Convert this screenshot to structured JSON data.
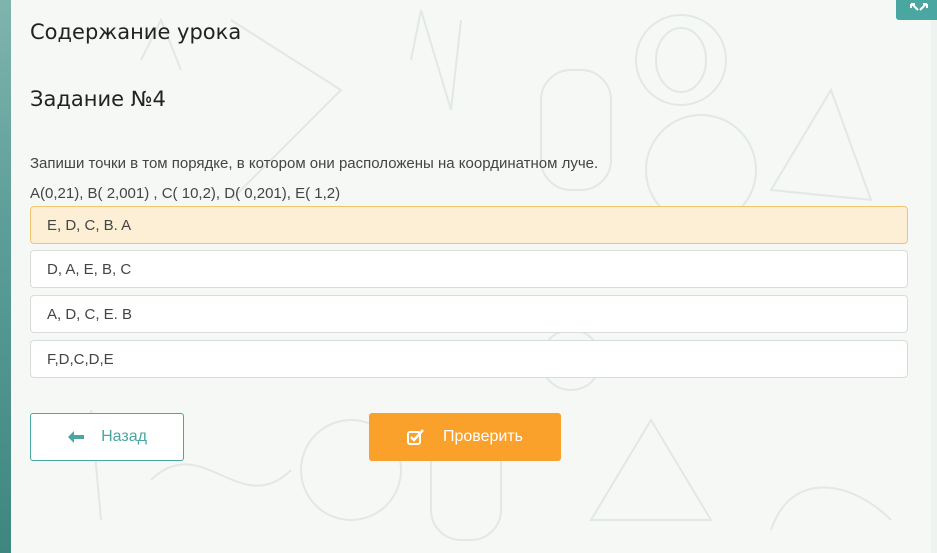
{
  "page": {
    "section_title": "Содержание урока",
    "task_title": "Задание №4"
  },
  "task": {
    "instruction": "Запиши точки в том порядке, в котором они расположены на координатном луче.",
    "points": "A(0,21), B( 2,001) , C( 10,2), D( 0,201), E( 1,2)",
    "options": [
      {
        "label": "E, D, C, B. A",
        "selected": true
      },
      {
        "label": "D, A, E, B, C",
        "selected": false
      },
      {
        "label": "A, D, C, E. B",
        "selected": false
      },
      {
        "label": "F,D,C,D,E",
        "selected": false
      }
    ]
  },
  "actions": {
    "back_label": "Назад",
    "check_label": "Проверить"
  },
  "icons": {
    "expand": "expand-icon",
    "back": "arrow-left-icon",
    "check": "checkbox-check-icon"
  },
  "colors": {
    "accent_teal": "#4aa6a0",
    "accent_orange": "#f9a12a",
    "selected_bg": "#fcefd5",
    "selected_border": "#f1c56d"
  }
}
